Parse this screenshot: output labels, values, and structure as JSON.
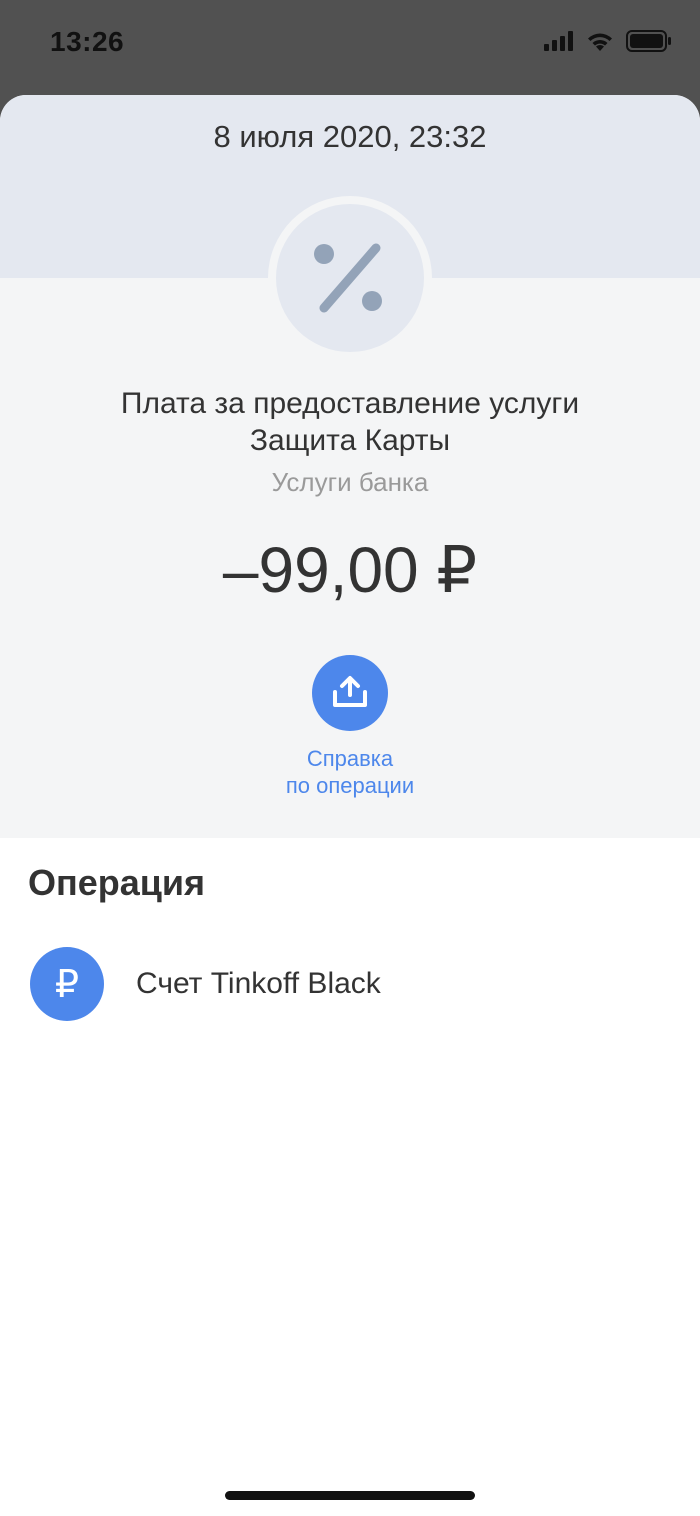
{
  "status_bar": {
    "time": "13:26"
  },
  "operation": {
    "date": "8 июля 2020, 23:32",
    "title_line1": "Плата за предоставление услуги",
    "title_line2": "Защита Карты",
    "category": "Услуги банка",
    "amount": "–99,00 ₽",
    "category_icon": "percent-icon",
    "receipt_label_line1": "Справка",
    "receipt_label_line2": "по операции"
  },
  "details": {
    "section_title": "Операция",
    "account_label": "Счет Tinkoff Black",
    "account_icon_glyph": "₽"
  },
  "colors": {
    "accent": "#4d87eb",
    "header_bg": "#e4e8f0",
    "card_bg": "#f4f5f6",
    "text_primary": "#333333",
    "text_secondary": "#9a9a9a"
  }
}
